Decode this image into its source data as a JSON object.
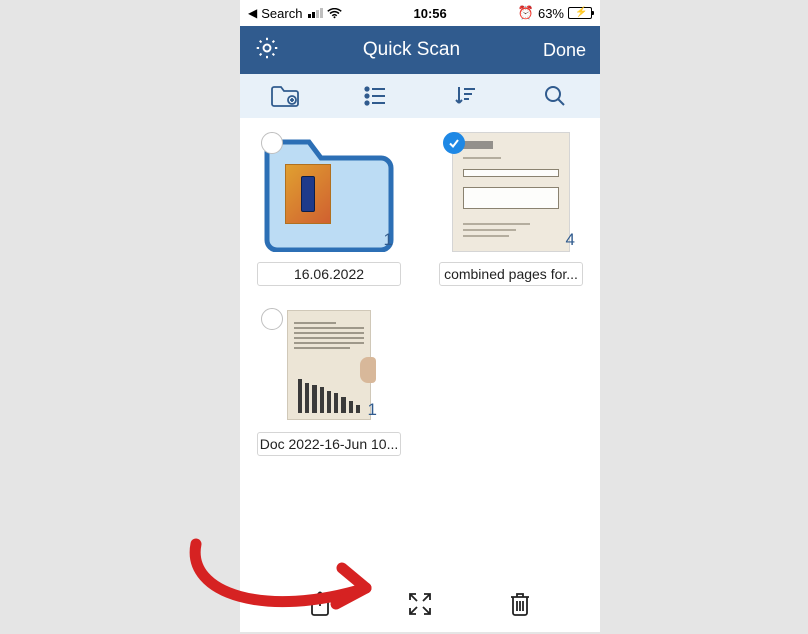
{
  "status": {
    "back_label": "Search",
    "time": "10:56",
    "battery_pct": "63%"
  },
  "nav": {
    "title": "Quick Scan",
    "done": "Done"
  },
  "items": [
    {
      "label": "16.06.2022",
      "count": "1",
      "selected": false,
      "type": "folder"
    },
    {
      "label": "combined pages for...",
      "count": "4",
      "selected": true,
      "type": "doc"
    },
    {
      "label": "Doc 2022-16-Jun 10...",
      "count": "1",
      "selected": false,
      "type": "doc2"
    }
  ]
}
